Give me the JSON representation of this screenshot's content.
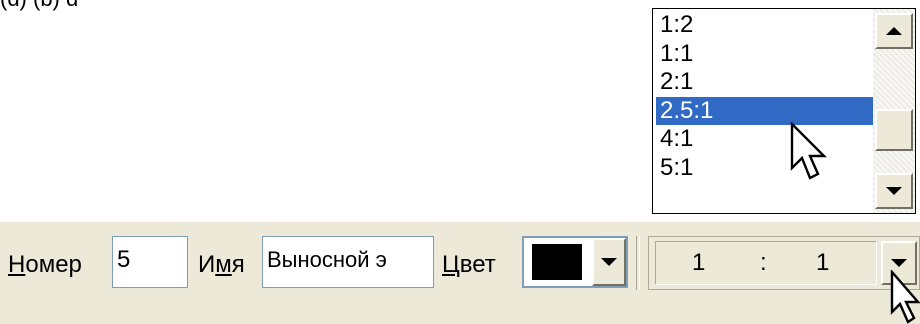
{
  "top_fragment": "(ɑ) (ƀ) ɑ",
  "scale_list": {
    "items": [
      "1:2",
      "1:1",
      "2:1",
      "2.5:1",
      "4:1",
      "5:1"
    ],
    "selected_index": 3
  },
  "toolbar": {
    "number": {
      "label_underlined": "Н",
      "label_rest": "омер",
      "value": "5"
    },
    "name": {
      "label_first": "И",
      "label_underlined": "м",
      "label_rest": "я",
      "value": "Выносной э"
    },
    "color": {
      "label_underlined": "Ц",
      "label_rest": "вет",
      "value_hex": "#000000"
    },
    "scale": {
      "left": "1",
      "separator": ":",
      "right": "1"
    }
  },
  "icons": {
    "scroll_up": "triangle-up",
    "scroll_down": "triangle-down",
    "dropdown": "triangle-down",
    "cursor": "mouse-pointer"
  }
}
